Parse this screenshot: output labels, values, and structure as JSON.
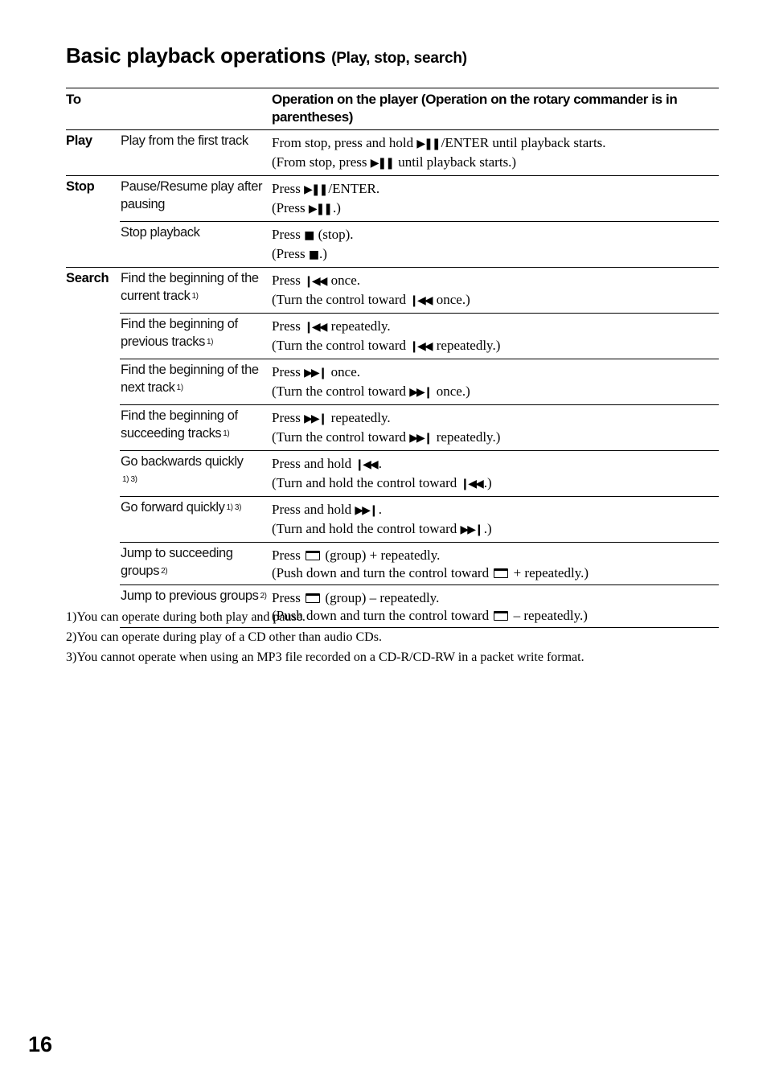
{
  "title": {
    "main": "Basic playback operations",
    "sub": "(Play, stop, search)"
  },
  "table": {
    "headers": [
      "To",
      "Operation on the player (Operation on the rotary commander is in parentheses)"
    ],
    "groups": [
      {
        "label": "Play",
        "rows": [
          {
            "action": "Play from the first track",
            "note": "",
            "op_line1": "From stop, press and hold [play-pause]/ENTER until playback starts.",
            "op_line2": "(From stop, press [play-pause] until playback starts.)"
          }
        ]
      },
      {
        "label": "Stop",
        "rows": [
          {
            "action": "Pause/Resume play after pausing",
            "note": "",
            "op_line1": "Press [play-pause]/ENTER.",
            "op_line2": "(Press [play-pause].)"
          },
          {
            "action": "Stop playback",
            "note": "",
            "op_line1": "Press [stop] (stop).",
            "op_line2": "(Press [stop].)"
          }
        ]
      },
      {
        "label": "Search",
        "rows": [
          {
            "action": "Find the beginning of the current track",
            "note": "1)",
            "op_line1": "Press [previous] once.",
            "op_line2": "(Turn the control toward [previous] once.)"
          },
          {
            "action": "Find the beginning of previous tracks",
            "note": "1)",
            "op_line1": "Press [previous] repeatedly.",
            "op_line2": "(Turn the control toward [previous] repeatedly.)"
          },
          {
            "action": "Find the beginning of the next track",
            "note": "1)",
            "op_line1": "Press [next] once.",
            "op_line2": "(Turn the control toward [next] once.)"
          },
          {
            "action": "Find the beginning of succeeding tracks",
            "note": "1)",
            "op_line1": "Press [next] repeatedly.",
            "op_line2": "(Turn the control toward [next] repeatedly.)"
          },
          {
            "action": "Go backwards quickly",
            "note": "1) 3)",
            "op_line1": "Press and hold [previous].",
            "op_line2": "(Turn and hold the control toward [previous].)"
          },
          {
            "action": "Go forward quickly",
            "note": "1) 3)",
            "op_line1": "Press and hold [next].",
            "op_line2": "(Turn and hold the control toward [next].)"
          },
          {
            "action": "Jump to succeeding groups",
            "note": "2)",
            "op_line1": "Press [group] (group) + repeatedly.",
            "op_line2": "(Push down and turn the control toward [group] + repeatedly.)"
          },
          {
            "action": "Jump to previous groups",
            "note": "2)",
            "op_line1": "Press [group] (group) – repeatedly.",
            "op_line2": "(Push down and turn the control toward [group] – repeatedly.)"
          }
        ]
      }
    ]
  },
  "icons": {
    "play-pause": "▶❚❚",
    "stop": "■",
    "previous": "❙◀◀",
    "next": "▶▶❙",
    "group": "folder-icon"
  },
  "footnotes": [
    "1)You can operate during both play and pause.",
    "2)You can operate during play of a CD other than audio CDs.",
    "3)You cannot operate when using an MP3 file recorded on a CD-R/CD-RW in a packet write format."
  ],
  "page_number": "16"
}
